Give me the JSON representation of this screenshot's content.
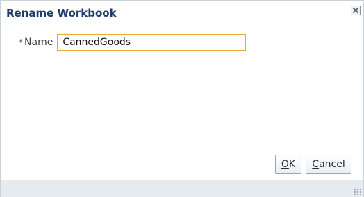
{
  "dialog": {
    "title": "Rename Workbook",
    "close_icon": "close-x-icon"
  },
  "form": {
    "required_marker": "*",
    "name_label_mnemonic": "N",
    "name_label_rest": "ame",
    "name_value": "CannedGoods"
  },
  "buttons": {
    "ok_mnemonic": "O",
    "ok_rest": "K",
    "cancel_mnemonic": "C",
    "cancel_rest": "ancel"
  },
  "colors": {
    "title": "#1d3b6b",
    "input_focus_border": "#e7a935",
    "footer_bg": "#e6ebef"
  }
}
